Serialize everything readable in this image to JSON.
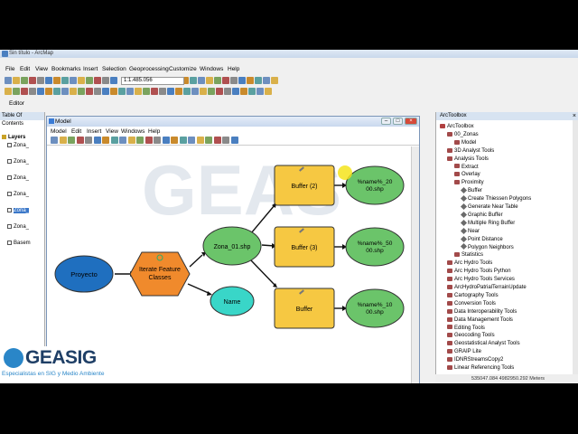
{
  "window": {
    "title": "Sin título - ArcMap"
  },
  "menu": [
    "File",
    "Edit",
    "View",
    "Bookmarks",
    "Insert",
    "Selection",
    "Geoprocessing",
    "Customize",
    "Windows",
    "Help"
  ],
  "toolbar": {
    "scale": "1:1.485.056",
    "editor_label": "Editor"
  },
  "toc": {
    "title": "Table Of Contents",
    "root": "Layers",
    "layers": [
      "Zona_",
      "Zona_",
      "Zona_",
      "Zona_",
      "Zona_",
      "Zona_",
      "Basem"
    ]
  },
  "model": {
    "title": "Model",
    "menu": [
      "Model",
      "Edit",
      "Insert",
      "View",
      "Windows",
      "Help"
    ],
    "nodes": {
      "proyecto": "Proyecto",
      "iterate": "Iterate Feature Classes",
      "zona": "Zona_01.shp",
      "name": "Name",
      "buffer2": "Buffer (2)",
      "buffer3": "Buffer (3)",
      "buffer1": "Buffer",
      "out1": "%name%_2000.shp",
      "out2": "%name%_5000.shp",
      "out3": "%name%_1000.shp"
    },
    "colors": {
      "input": "#1f6fbf",
      "iterator": "#f08a2c",
      "data": "#6bc46a",
      "variable": "#39d6c8",
      "tool": "#f6c842"
    }
  },
  "arctoolbox": {
    "title": "ArcToolbox",
    "items": [
      {
        "label": "ArcToolbox",
        "level": 0
      },
      {
        "label": "00_Zonas",
        "level": 1
      },
      {
        "label": "Model",
        "level": 2
      },
      {
        "label": "3D Analyst Tools",
        "level": 1
      },
      {
        "label": "Analysis Tools",
        "level": 1
      },
      {
        "label": "Extract",
        "level": 2
      },
      {
        "label": "Overlay",
        "level": 2
      },
      {
        "label": "Proximity",
        "level": 2
      },
      {
        "label": "Buffer",
        "level": 3
      },
      {
        "label": "Create Thiessen Polygons",
        "level": 3
      },
      {
        "label": "Generate Near Table",
        "level": 3
      },
      {
        "label": "Graphic Buffer",
        "level": 3
      },
      {
        "label": "Multiple Ring Buffer",
        "level": 3
      },
      {
        "label": "Near",
        "level": 3
      },
      {
        "label": "Point Distance",
        "level": 3
      },
      {
        "label": "Polygon Neighbors",
        "level": 3
      },
      {
        "label": "Statistics",
        "level": 2
      },
      {
        "label": "Arc Hydro Tools",
        "level": 1
      },
      {
        "label": "Arc Hydro Tools Python",
        "level": 1
      },
      {
        "label": "Arc Hydro Tools Services",
        "level": 1
      },
      {
        "label": "ArcHydroPatrialTerrainUpdate",
        "level": 1
      },
      {
        "label": "Cartography Tools",
        "level": 1
      },
      {
        "label": "Conversion Tools",
        "level": 1
      },
      {
        "label": "Data Interoperability Tools",
        "level": 1
      },
      {
        "label": "Data Management Tools",
        "level": 1
      },
      {
        "label": "Editing Tools",
        "level": 1
      },
      {
        "label": "Geocoding Tools",
        "level": 1
      },
      {
        "label": "Geostatistical Analyst Tools",
        "level": 1
      },
      {
        "label": "GRAIP Lite",
        "level": 1
      },
      {
        "label": "IDNRStreamsCopy2",
        "level": 1
      },
      {
        "label": "Linear Referencing Tools",
        "level": 1
      }
    ]
  },
  "status": {
    "coords": "535047.084  4982950.292 Meters"
  },
  "logo": {
    "name": "GEASIG",
    "tagline": "Especialistas en SIG y Medio Ambiente"
  }
}
